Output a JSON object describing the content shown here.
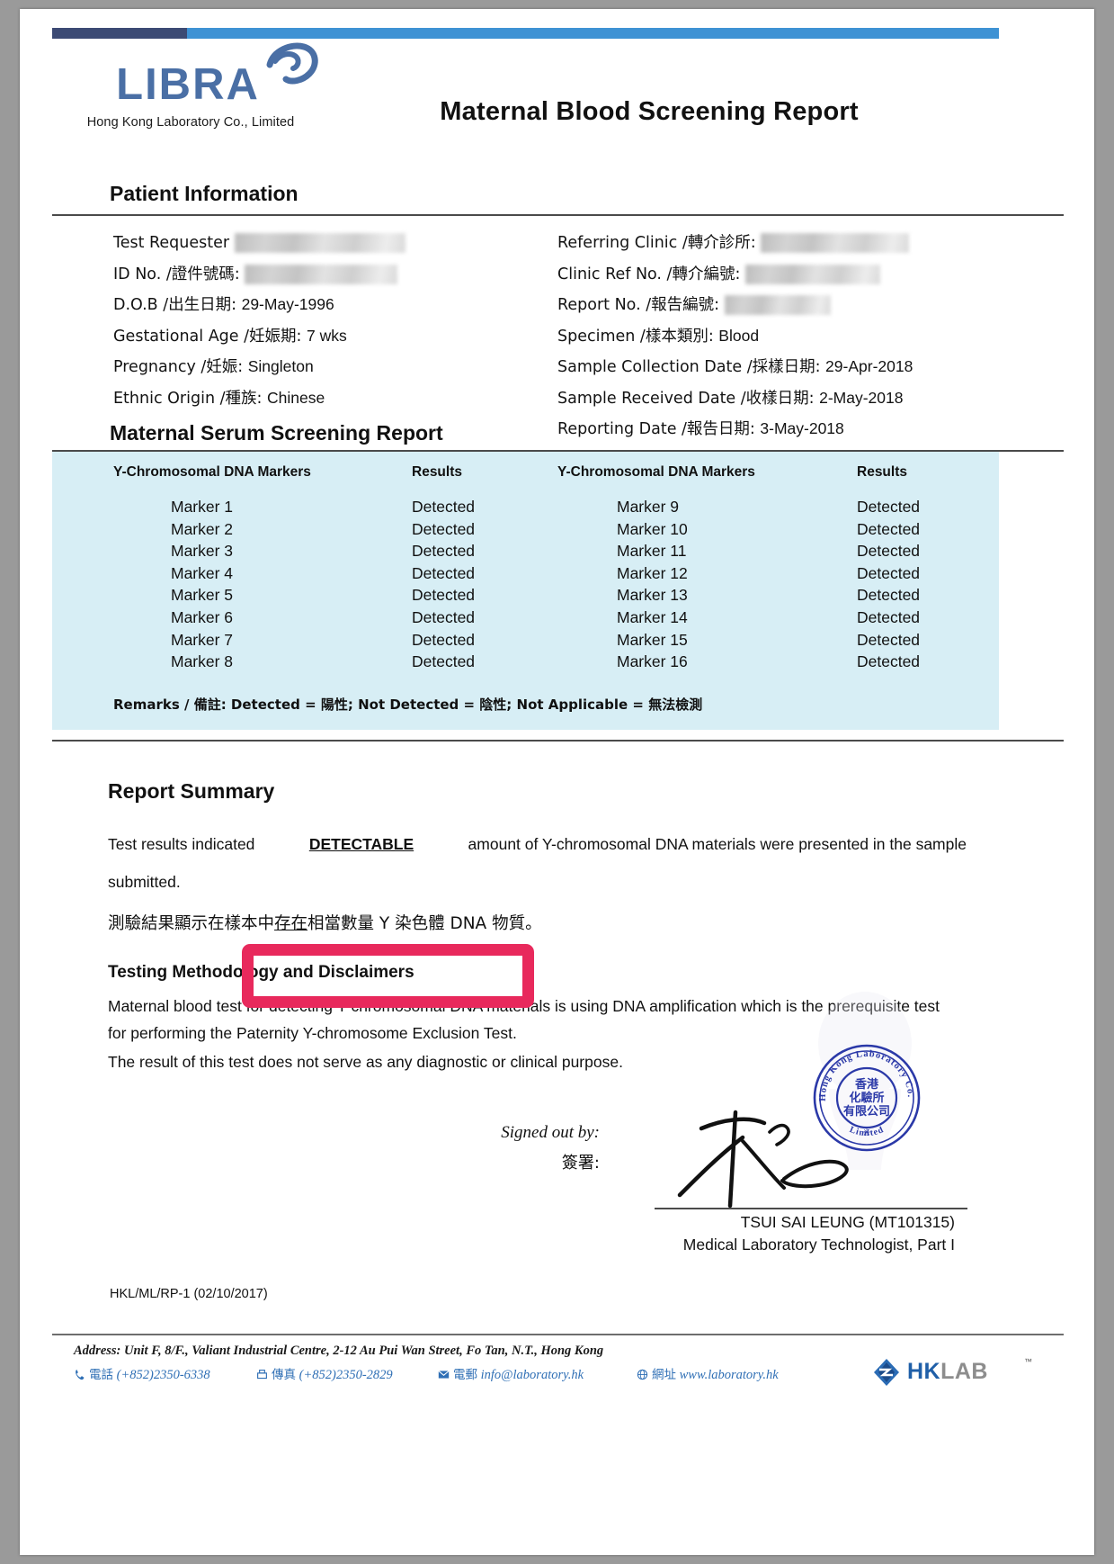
{
  "document": {
    "title": "Maternal Blood Screening Report",
    "logo_text": "LIBRA",
    "logo_subtitle": "Hong Kong Laboratory Co., Limited"
  },
  "patient_section": {
    "heading": "Patient Information",
    "left_fields": [
      {
        "label": "Test Requester",
        "value": "",
        "redacted": true,
        "redact_width": 190
      },
      {
        "label": "ID No. /證件號碼:",
        "value": "",
        "redacted": true,
        "redact_width": 170
      },
      {
        "label": "D.O.B /出生日期:",
        "value": "29-May-1996",
        "redacted": false
      },
      {
        "label": "Gestational Age /妊娠期:",
        "value": "7 wks",
        "redacted": false
      },
      {
        "label": "Pregnancy /妊娠:",
        "value": "Singleton",
        "redacted": false
      },
      {
        "label": "Ethnic Origin /種族:",
        "value": "Chinese",
        "redacted": false
      }
    ],
    "right_fields": [
      {
        "label": "Referring Clinic /轉介診所:",
        "value": "",
        "redacted": true,
        "redact_width": 165
      },
      {
        "label": "Clinic Ref No. /轉介編號:",
        "value": "",
        "redacted": true,
        "redact_width": 150
      },
      {
        "label": "Report No. /報告編號:",
        "value": "",
        "redacted": true,
        "redact_width": 118
      },
      {
        "label": "Specimen /樣本類別:",
        "value": "Blood",
        "redacted": false
      },
      {
        "label": "Sample Collection Date /採樣日期:",
        "value": "29-Apr-2018",
        "redacted": false
      },
      {
        "label": "Sample Received Date /收樣日期:",
        "value": "2-May-2018",
        "redacted": false
      },
      {
        "label": "Reporting Date /報告日期:",
        "value": "3-May-2018",
        "redacted": false
      }
    ]
  },
  "serum_section": {
    "heading": "Maternal Serum Screening Report",
    "columns": [
      {
        "marker_header": "Y-Chromosomal DNA Markers",
        "result_header": "Results"
      },
      {
        "marker_header": "Y-Chromosomal DNA Markers",
        "result_header": "Results"
      }
    ],
    "left_rows": [
      {
        "marker": "Marker 1",
        "result": "Detected"
      },
      {
        "marker": "Marker 2",
        "result": "Detected"
      },
      {
        "marker": "Marker 3",
        "result": "Detected"
      },
      {
        "marker": "Marker 4",
        "result": "Detected"
      },
      {
        "marker": "Marker 5",
        "result": "Detected"
      },
      {
        "marker": "Marker 6",
        "result": "Detected"
      },
      {
        "marker": "Marker 7",
        "result": "Detected"
      },
      {
        "marker": "Marker 8",
        "result": "Detected"
      }
    ],
    "right_rows": [
      {
        "marker": "Marker 9",
        "result": "Detected"
      },
      {
        "marker": "Marker 10",
        "result": "Detected"
      },
      {
        "marker": "Marker 11",
        "result": "Detected"
      },
      {
        "marker": "Marker 12",
        "result": "Detected"
      },
      {
        "marker": "Marker 13",
        "result": "Detected"
      },
      {
        "marker": "Marker 14",
        "result": "Detected"
      },
      {
        "marker": "Marker 15",
        "result": "Detected"
      },
      {
        "marker": "Marker 16",
        "result": "Detected"
      }
    ],
    "remarks": "Remarks / 備註: Detected = 陽性; Not Detected = 陰性; Not Applicable = 無法檢測",
    "panel_color": "#d7eef5"
  },
  "summary_section": {
    "heading": "Report Summary",
    "line1_part1": "Test results indicated",
    "line1_emphasis": "DETECTABLE",
    "line1_part2": "amount of Y-chromosomal DNA materials were presented in the sample",
    "line2": "submitted.",
    "chinese_pre": "測驗結果顯示在樣本中",
    "chinese_emphasis": "存在",
    "chinese_post": "相當數量 Y 染色體 DNA 物質。",
    "highlight_color": "#e8295c"
  },
  "methodology_section": {
    "heading": "Testing Methodology and Disclaimers",
    "lines": [
      "Maternal blood test for detecting Y-chromosomal DNA materials is using DNA amplification which is the prerequisite test",
      "for performing the Paternity Y-chromosome Exclusion Test.",
      "The result of this test does not serve as any diagnostic or clinical purpose."
    ]
  },
  "signature_section": {
    "label_en": "Signed out by:",
    "label_cn": "簽署:",
    "name": "TSUI SAI LEUNG (MT101315)",
    "position": "Medical Laboratory Technologist, Part I",
    "stamp_outer_top": "Hong Kong Laboratory Co.,",
    "stamp_outer_bottom": "Limited",
    "stamp_inner": "香港化驗所有限公司",
    "stamp_color": "#2b39a8"
  },
  "form_code": "HKL/ML/RP-1 (02/10/2017)",
  "footer": {
    "address": "Address: Unit F, 8/F., Valiant Industrial Centre, 2-12 Au Pui Wan Street, Fo Tan, N.T., Hong Kong",
    "phone_label": "電話",
    "phone": "(+852)2350-6338",
    "fax_label": "傳真",
    "fax": "(+852)2350-2829",
    "email_label": "電郵",
    "email": "info@laboratory.hk",
    "web_label": "網址",
    "web": "www.laboratory.hk",
    "brand_hk": "HK",
    "brand_lab": "LAB",
    "brand_tm": "™",
    "accent_color": "#2f6fb5"
  }
}
